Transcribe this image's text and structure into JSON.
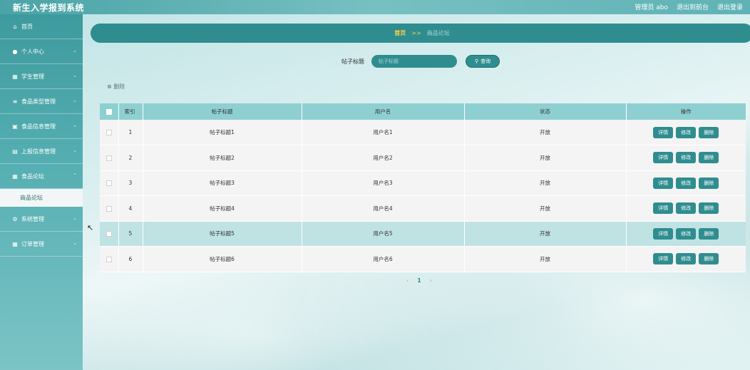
{
  "app": {
    "title": "新生入学报到系统"
  },
  "topbar": {
    "user": "管理员 abo",
    "back_label": "退出到前台",
    "logout_label": "退出登录"
  },
  "sidebar": {
    "items": [
      {
        "label": "首页",
        "icon": "home-icon"
      },
      {
        "label": "个人中心",
        "icon": "user-icon"
      },
      {
        "label": "学生管理",
        "icon": "grid-icon"
      },
      {
        "label": "食品类型管理",
        "icon": "sliders-icon"
      },
      {
        "label": "食品信息管理",
        "icon": "card-icon"
      },
      {
        "label": "上报信息管理",
        "icon": "doc-icon"
      },
      {
        "label": "食品论坛",
        "icon": "grid-icon"
      },
      {
        "label": "系统管理",
        "icon": "gear-icon"
      },
      {
        "label": "订单管理",
        "icon": "grid-icon"
      }
    ],
    "submenu": {
      "label": "商品论坛"
    }
  },
  "breadcrumb": {
    "home": "首页",
    "sep": ">>",
    "current": "商品论坛"
  },
  "search": {
    "label": "帖子标题",
    "placeholder": "帖子标题",
    "button": "查询"
  },
  "actions": {
    "delete": "删除"
  },
  "table": {
    "headers": [
      "索引",
      "帖子标题",
      "用户名",
      "状态",
      "操作"
    ],
    "rows": [
      {
        "index": "1",
        "title": "帖子标题1",
        "user": "用户名1",
        "status": "开放"
      },
      {
        "index": "2",
        "title": "帖子标题2",
        "user": "用户名2",
        "status": "开放"
      },
      {
        "index": "3",
        "title": "帖子标题3",
        "user": "用户名3",
        "status": "开放"
      },
      {
        "index": "4",
        "title": "帖子标题4",
        "user": "用户名4",
        "status": "开放"
      },
      {
        "index": "5",
        "title": "帖子标题5",
        "user": "用户名5",
        "status": "开放"
      },
      {
        "index": "6",
        "title": "帖子标题6",
        "user": "用户名6",
        "status": "开放"
      }
    ],
    "row_buttons": {
      "detail": "详情",
      "edit": "修改",
      "delete": "删除"
    }
  },
  "pager": {
    "prev": "‹",
    "current": "1",
    "next": "›"
  },
  "colors": {
    "accent": "#2f8d8f",
    "header_row": "#8ed0d2",
    "breadcrumb_home": "#ffd24a"
  }
}
